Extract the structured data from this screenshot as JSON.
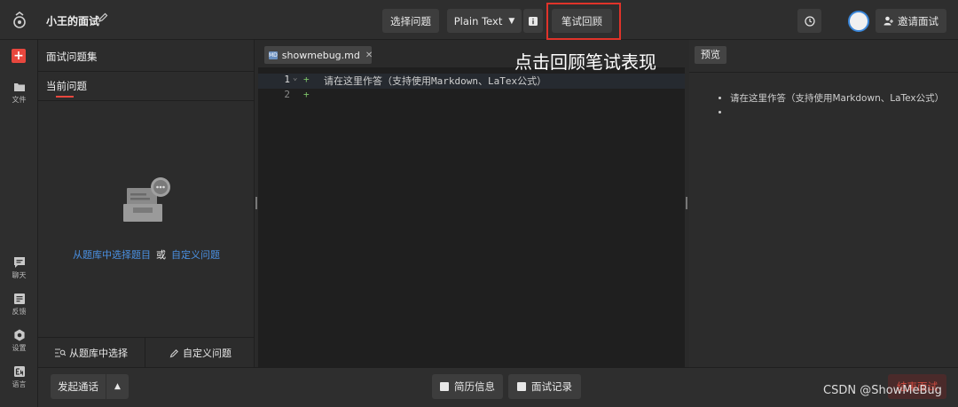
{
  "app": {
    "interview_title": "小王的面试"
  },
  "toolbar": {
    "select_question_label": "选择问题",
    "language_label": "Plain Text",
    "review_label": "笔试回顾",
    "invite_label": "邀请面试",
    "history_icon": "clock-icon",
    "info_icon": "info-icon"
  },
  "annotation": {
    "text": "点击回顾笔试表现",
    "highlight_color": "#e0332a"
  },
  "rail": {
    "items": [
      {
        "label": "文件",
        "icon": "folder-icon"
      },
      {
        "label": "聊天",
        "icon": "chat-icon"
      },
      {
        "label": "反馈",
        "icon": "feedback-icon"
      },
      {
        "label": "设置",
        "icon": "gear-icon"
      },
      {
        "label": "语言",
        "icon": "language-icon"
      }
    ]
  },
  "question_panel": {
    "header": "面试问题集",
    "current_tab": "当前问题",
    "empty_link_bank": "从题库中选择题目",
    "empty_or": "或",
    "empty_link_custom": "自定义问题",
    "footer_bank": "从题库中选择",
    "footer_custom": "自定义问题"
  },
  "editor": {
    "file_tab": "showmebug.md",
    "file_badge": "MD",
    "lines": [
      {
        "number": "1",
        "text": "请在这里作答（支持使用Markdown、LaTex公式）"
      },
      {
        "number": "2",
        "text": ""
      }
    ]
  },
  "preview": {
    "label": "预览",
    "items": [
      "请在这里作答（支持使用Markdown、LaTex公式）",
      ""
    ]
  },
  "bottom": {
    "call_label": "发起通话",
    "resume_label": "简历信息",
    "record_label": "面试记录",
    "end_label": "结束面试"
  },
  "watermark": "CSDN @ShowMeBug",
  "colors": {
    "accent_red": "#e8473e",
    "link_blue": "#4a90e2",
    "diff_green": "#7cc168"
  }
}
